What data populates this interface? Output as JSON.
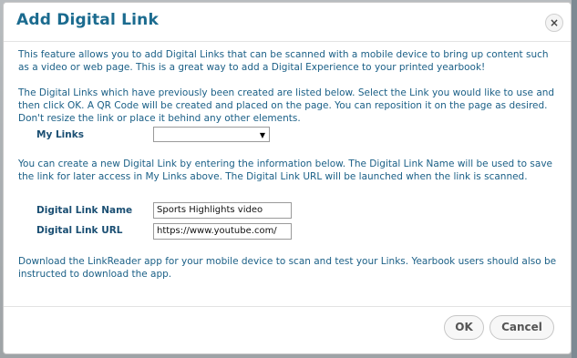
{
  "dialog": {
    "title": "Add Digital Link",
    "close_symbol": "×",
    "intro_text": "This feature allows you to add Digital Links that can be scanned with a mobile device to bring up content such as a video or web page. This is a great way to add a Digital Experience to your printed yearbook!",
    "existing_text": "The Digital Links which have previously been created are listed below. Select the Link you would like to use and then click OK. A QR Code will be created and placed on the page. You can reposition it on the page as desired. Don't resize the link or place it behind any other elements.",
    "my_links_label": "My Links",
    "my_links_selected": "",
    "create_text": "You can create a new Digital Link by entering the information below. The Digital Link Name will be used to save the link for later access in My Links above. The Digital Link URL will be launched when the link is scanned.",
    "link_name_label": "Digital Link Name",
    "link_name_value": "Sports Highlights video",
    "link_url_label": "Digital Link URL",
    "link_url_value": "https://www.youtube.com/",
    "download_text": "Download the LinkReader app for your mobile device to scan and test your Links. Yearbook users should also be instructed to download the app.",
    "ok_label": "OK",
    "cancel_label": "Cancel"
  },
  "icons": {
    "close": "close-icon",
    "dropdown": "chevron-down-icon"
  },
  "colors": {
    "title": "#1b6b8f",
    "body_text": "#1a5f86",
    "label_text": "#1b4f73"
  }
}
